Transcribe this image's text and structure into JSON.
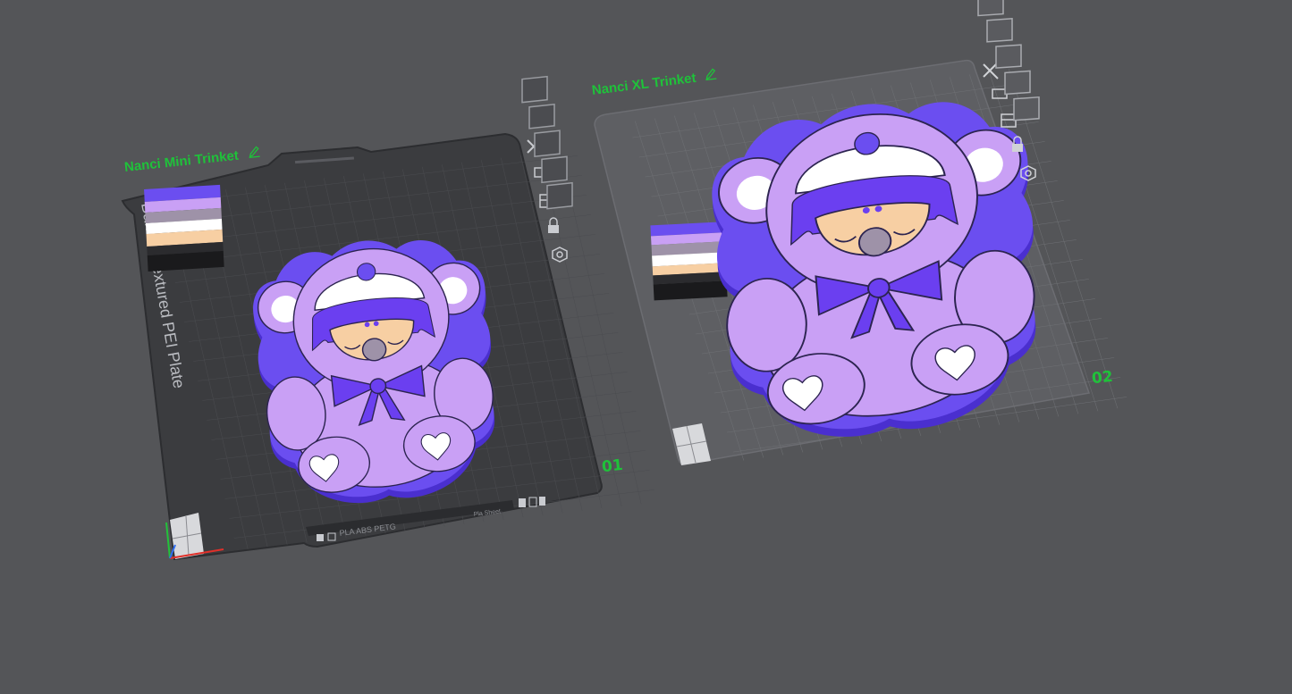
{
  "colors": {
    "background": "#545558",
    "label_green": "#1fc23a",
    "dark_plate": "#3b3c3f",
    "light_plate": "#5e5f63",
    "model_outline": "#6b4ef0",
    "model_fill": "#c9a0f5",
    "model_hat": "#ffffff",
    "model_skin": "#f7cfa3",
    "model_nose": "#9e92a8",
    "model_bow": "#6b3ff0"
  },
  "plates": [
    {
      "name": "Nanci Mini Trinket",
      "number": "01",
      "plate_type_text": "Bambu Textured PEI Plate",
      "filament_text": "PLA ABS PETG",
      "status_text": "Pla Sheet",
      "icons": [
        "close-icon",
        "auto-orient-icon",
        "arrange-icon",
        "lock-icon",
        "settings-icon"
      ]
    },
    {
      "name": "Nanci XL Trinket",
      "number": "02",
      "icons": [
        "close-icon",
        "auto-orient-icon",
        "arrange-icon",
        "lock-icon",
        "settings-icon"
      ]
    }
  ],
  "color_swatches": [
    "#6b4ef0",
    "#c9a0f5",
    "#9e92a8",
    "#ffffff",
    "#f7cfa3",
    "#2b2b2e",
    "#1a1a1c"
  ]
}
